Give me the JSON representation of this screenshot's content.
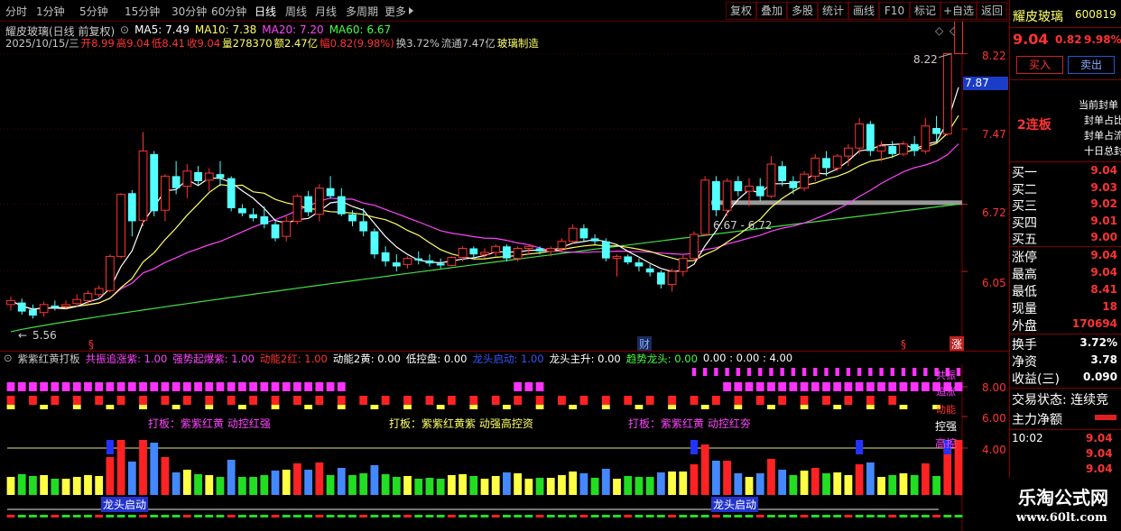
{
  "app": {
    "stock_name": "耀皮玻璃",
    "stock_code": "600819"
  },
  "toolbar": {
    "periods": [
      "分时",
      "1分钟",
      "5分钟",
      "15分钟",
      "30分钟",
      "60分钟",
      "日线",
      "周线",
      "月线",
      "多周期",
      "更多"
    ],
    "active_period": "日线",
    "buttons": [
      "复权",
      "叠加",
      "多股",
      "统计",
      "画线",
      "F10",
      "标记",
      "+自选",
      "返回"
    ]
  },
  "main_chart": {
    "header": "耀皮玻璃(日线 前复权)",
    "ma_toggle_label": "MA5: 7.49",
    "ma": [
      {
        "label": "MA5: 7.49",
        "color": "#ffffff"
      },
      {
        "label": "MA10: 7.38",
        "color": "#ffff66"
      },
      {
        "label": "MA20: 7.20",
        "color": "#ff44ff"
      },
      {
        "label": "MA60: 6.67",
        "color": "#44ff44"
      }
    ],
    "info": {
      "date": "2025/10/15/三",
      "open": "开8.99",
      "high": "高9.04",
      "low": "低8.41",
      "close": "收9.04",
      "vol": "量278370",
      "amt": "额2.47亿",
      "amp": "幅0.82(9.98%)",
      "turnover": "换3.72%",
      "float": "流通7.47亿",
      "industry": "玻璃制造"
    },
    "price_axis": {
      "ticks": [
        "8.22",
        "7.47",
        "6.72",
        "6.05"
      ],
      "current": "7.87"
    },
    "annotations": {
      "high_label": "8.22",
      "low_label": "5.56",
      "zone_label": "6.67 - 6.72"
    },
    "markers": {
      "fin": "财",
      "s1": "§",
      "s2": "§",
      "zhang": "涨"
    }
  },
  "indicator": {
    "title": "紫紫红黄打板",
    "legend": [
      {
        "label": "共振追涨紫: 1.00",
        "color": "#ff44ff"
      },
      {
        "label": "强势起爆紫: 1.00",
        "color": "#ff44ff"
      },
      {
        "label": "动能2红: 1.00",
        "color": "#ff3333"
      },
      {
        "label": "动能2黄: 0.00",
        "color": "#ffffff"
      },
      {
        "label": "低控盘: 0.00",
        "color": "#ffffff"
      },
      {
        "label": "龙头启动: 1.00",
        "color": "#3355ff"
      },
      {
        "label": "龙头主升: 0.00",
        "color": "#ffffff"
      },
      {
        "label": "趋势龙头: 0.00",
        "color": "#44ff44"
      },
      {
        "label": "0.00 : 0.00 : 4.00",
        "color": "#ffffff"
      }
    ],
    "axis_ticks": [
      "8.00",
      "6.00",
      "4.00"
    ],
    "texts": {
      "t1": "打板：紫紫红黄 动控红强",
      "t2": "打板：紫紫红黄紫 动强高控资",
      "t3": "打板：紫紫红黄 动控红夯",
      "dragon1": "龙头启动",
      "dragon2": "龙头启动",
      "kq": "控强",
      "gk": "高控",
      "gb": "共振",
      "qb": "追涨",
      "dn": "动能"
    }
  },
  "quote": {
    "price": "9.04",
    "change": "0.82",
    "pct": "9.98%",
    "buy_btn": "买入",
    "sell_btn": "卖出",
    "badge": "2连板",
    "notes": [
      "当前封单",
      "封单占比",
      "封单占流",
      "十日总封"
    ],
    "bids": [
      {
        "name": "买一",
        "price": "9.04"
      },
      {
        "name": "买二",
        "price": "9.03"
      },
      {
        "name": "买三",
        "price": "9.02"
      },
      {
        "name": "买四",
        "price": "9.01"
      },
      {
        "name": "买五",
        "price": "9.00"
      }
    ],
    "stats": [
      {
        "name": "涨停",
        "value": "9.04",
        "color": "#ff3333"
      },
      {
        "name": "最高",
        "value": "9.04",
        "color": "#ff3333"
      },
      {
        "name": "最低",
        "value": "8.41",
        "color": "#ff3333"
      },
      {
        "name": "现量",
        "value": "18",
        "color": "#ff3333"
      },
      {
        "name": "外盘",
        "value": "170694",
        "color": "#ff3333"
      }
    ],
    "stats2": [
      {
        "name": "换手",
        "value": "3.72%",
        "color": "#ffffff"
      },
      {
        "name": "净资",
        "value": "3.78",
        "color": "#ffffff"
      },
      {
        "name": "收益(三)",
        "value": "0.090",
        "color": "#ffffff"
      }
    ],
    "trade_status": "交易状态: 连续竞",
    "net_flow": "主力净额",
    "ticks": [
      {
        "time": "10:02",
        "price": "9.04"
      },
      {
        "time": "",
        "price": "9.04"
      },
      {
        "time": "",
        "price": "9.04"
      }
    ]
  },
  "watermark": {
    "title": "乐淘公式网",
    "url": "www.60lt.com"
  },
  "chart_data": {
    "type": "candlestick",
    "title": "耀皮玻璃(日线 前复权)",
    "ylim": [
      5.35,
      8.45
    ],
    "candles": [
      [
        5.72,
        5.8,
        5.66,
        5.76
      ],
      [
        5.74,
        5.78,
        5.62,
        5.65
      ],
      [
        5.67,
        5.72,
        5.58,
        5.61
      ],
      [
        5.64,
        5.75,
        5.6,
        5.72
      ],
      [
        5.71,
        5.76,
        5.66,
        5.69
      ],
      [
        5.7,
        5.76,
        5.68,
        5.72
      ],
      [
        5.73,
        5.82,
        5.7,
        5.77
      ],
      [
        5.76,
        5.86,
        5.72,
        5.83
      ],
      [
        5.82,
        5.91,
        5.79,
        5.88
      ],
      [
        5.86,
        6.22,
        5.84,
        6.2
      ],
      [
        6.2,
        6.83,
        6.18,
        6.82
      ],
      [
        6.83,
        6.86,
        6.4,
        6.55
      ],
      [
        6.56,
        7.44,
        6.5,
        7.25
      ],
      [
        7.22,
        7.25,
        6.6,
        6.65
      ],
      [
        6.66,
        7.02,
        6.55,
        7.0
      ],
      [
        7.0,
        7.15,
        6.82,
        6.88
      ],
      [
        6.9,
        7.12,
        6.78,
        7.05
      ],
      [
        7.04,
        7.1,
        6.9,
        6.95
      ],
      [
        6.96,
        7.08,
        6.85,
        7.03
      ],
      [
        7.02,
        7.15,
        6.9,
        6.98
      ],
      [
        6.98,
        7.0,
        6.65,
        6.68
      ],
      [
        6.68,
        6.72,
        6.6,
        6.63
      ],
      [
        6.62,
        6.68,
        6.55,
        6.58
      ],
      [
        6.6,
        6.7,
        6.48,
        6.52
      ],
      [
        6.52,
        6.55,
        6.35,
        6.38
      ],
      [
        6.4,
        6.6,
        6.35,
        6.55
      ],
      [
        6.55,
        6.82,
        6.52,
        6.8
      ],
      [
        6.8,
        6.85,
        6.6,
        6.64
      ],
      [
        6.62,
        6.92,
        6.55,
        6.88
      ],
      [
        6.88,
        7.0,
        6.78,
        6.8
      ],
      [
        6.8,
        6.88,
        6.6,
        6.62
      ],
      [
        6.62,
        6.66,
        6.5,
        6.55
      ],
      [
        6.55,
        6.68,
        6.4,
        6.45
      ],
      [
        6.45,
        6.48,
        6.18,
        6.22
      ],
      [
        6.24,
        6.3,
        6.1,
        6.15
      ],
      [
        6.14,
        6.22,
        6.05,
        6.1
      ],
      [
        6.12,
        6.2,
        6.08,
        6.18
      ],
      [
        6.18,
        6.25,
        6.12,
        6.16
      ],
      [
        6.16,
        6.22,
        6.1,
        6.13
      ],
      [
        6.13,
        6.18,
        6.08,
        6.11
      ],
      [
        6.11,
        6.2,
        6.1,
        6.19
      ],
      [
        6.19,
        6.3,
        6.15,
        6.28
      ],
      [
        6.28,
        6.3,
        6.18,
        6.22
      ],
      [
        6.22,
        6.28,
        6.18,
        6.24
      ],
      [
        6.24,
        6.32,
        6.2,
        6.3
      ],
      [
        6.3,
        6.32,
        6.15,
        6.18
      ],
      [
        6.18,
        6.3,
        6.15,
        6.28
      ],
      [
        6.28,
        6.32,
        6.22,
        6.3
      ],
      [
        6.28,
        6.3,
        6.22,
        6.25
      ],
      [
        6.25,
        6.3,
        6.2,
        6.28
      ],
      [
        6.28,
        6.38,
        6.25,
        6.35
      ],
      [
        6.35,
        6.52,
        6.32,
        6.48
      ],
      [
        6.48,
        6.52,
        6.35,
        6.38
      ],
      [
        6.38,
        6.42,
        6.32,
        6.35
      ],
      [
        6.35,
        6.38,
        6.15,
        6.18
      ],
      [
        6.18,
        6.22,
        6.0,
        6.2
      ],
      [
        6.2,
        6.22,
        6.12,
        6.14
      ],
      [
        6.14,
        6.18,
        6.05,
        6.1
      ],
      [
        6.08,
        6.12,
        6.0,
        6.04
      ],
      [
        6.04,
        6.06,
        5.88,
        5.92
      ],
      [
        5.92,
        6.08,
        5.85,
        6.05
      ],
      [
        6.05,
        6.22,
        6.0,
        6.18
      ],
      [
        6.18,
        6.45,
        6.15,
        6.42
      ],
      [
        6.42,
        7.0,
        6.4,
        6.96
      ],
      [
        6.95,
        7.0,
        6.6,
        6.66
      ],
      [
        6.66,
        6.98,
        6.6,
        6.95
      ],
      [
        6.95,
        7.0,
        6.8,
        6.85
      ],
      [
        6.85,
        6.98,
        6.7,
        6.9
      ],
      [
        6.9,
        6.98,
        6.75,
        6.8
      ],
      [
        6.8,
        7.2,
        6.78,
        7.12
      ],
      [
        7.1,
        7.15,
        6.9,
        6.95
      ],
      [
        6.95,
        7.0,
        6.82,
        6.88
      ],
      [
        6.88,
        7.05,
        6.85,
        7.02
      ],
      [
        7.0,
        7.22,
        6.95,
        7.18
      ],
      [
        7.18,
        7.25,
        7.0,
        7.08
      ],
      [
        7.08,
        7.22,
        7.05,
        7.2
      ],
      [
        7.2,
        7.32,
        7.1,
        7.28
      ],
      [
        7.28,
        7.58,
        7.22,
        7.52
      ],
      [
        7.52,
        7.55,
        7.2,
        7.25
      ],
      [
        7.25,
        7.35,
        7.15,
        7.3
      ],
      [
        7.3,
        7.35,
        7.18,
        7.22
      ],
      [
        7.22,
        7.35,
        7.2,
        7.32
      ],
      [
        7.32,
        7.4,
        7.2,
        7.25
      ],
      [
        7.25,
        7.58,
        7.22,
        7.5
      ],
      [
        7.48,
        7.6,
        7.35,
        7.42
      ],
      [
        7.42,
        8.18,
        7.4,
        8.22
      ],
      [
        8.22,
        9.04,
        8.41,
        9.04
      ]
    ]
  }
}
